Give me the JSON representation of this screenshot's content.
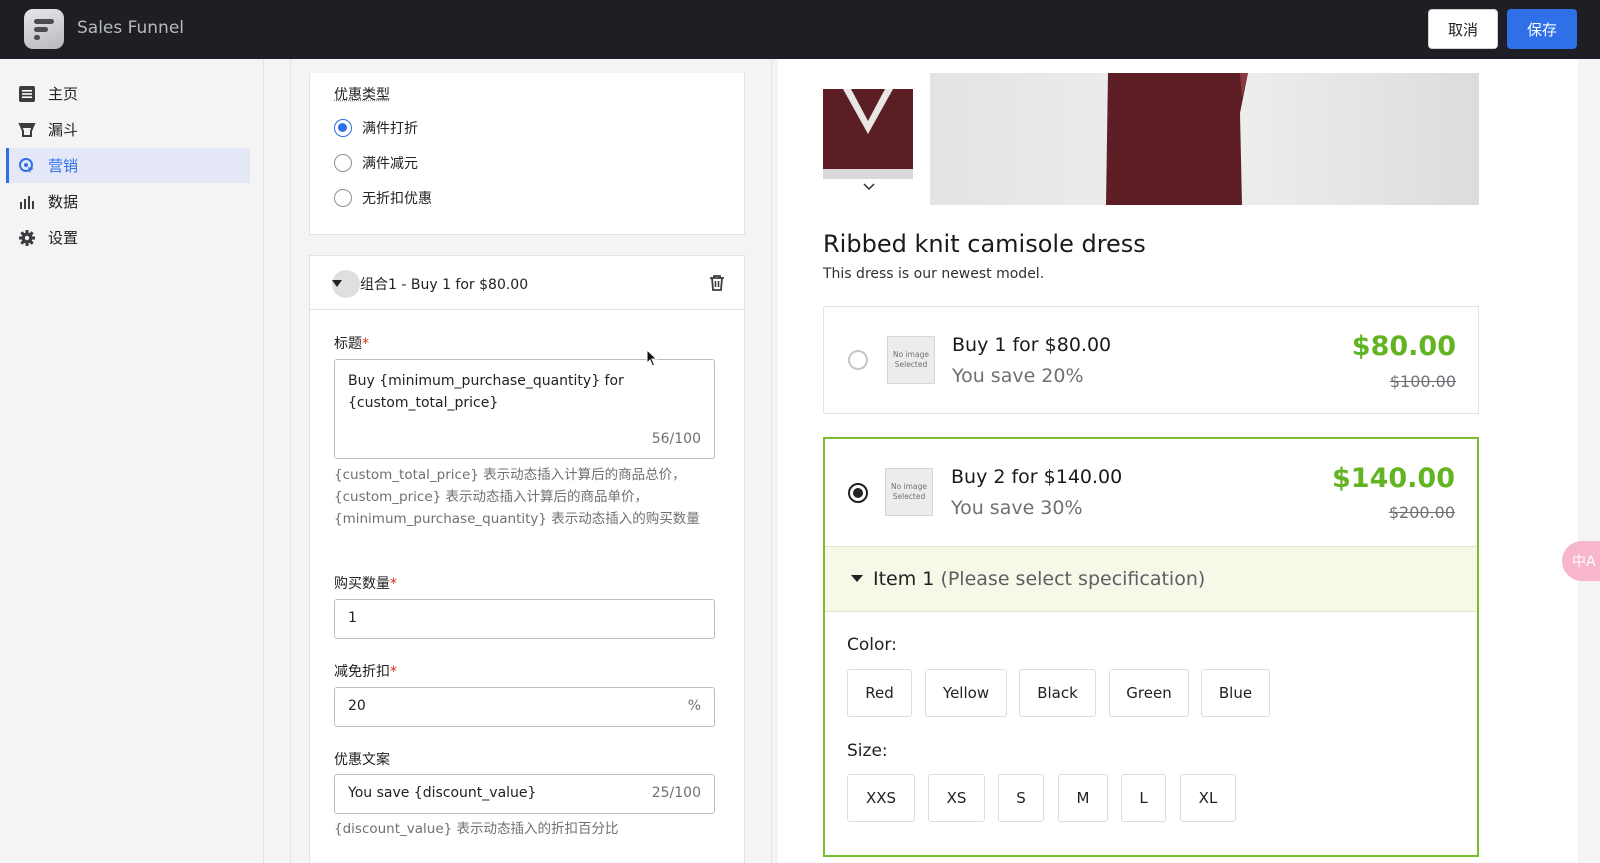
{
  "app": {
    "title": "Sales Funnel"
  },
  "topbar": {
    "cancel_label": "取消",
    "save_label": "保存"
  },
  "sidebar": {
    "items": [
      {
        "label": "主页",
        "icon": "list-icon"
      },
      {
        "label": "漏斗",
        "icon": "funnel-icon"
      },
      {
        "label": "营销",
        "icon": "marketing-icon",
        "active": true
      },
      {
        "label": "数据",
        "icon": "bar-chart-icon"
      },
      {
        "label": "设置",
        "icon": "gear-icon"
      }
    ]
  },
  "discount_type": {
    "label": "优惠类型",
    "options": [
      {
        "label": "满件打折",
        "selected": true
      },
      {
        "label": "满件减元",
        "selected": false
      },
      {
        "label": "无折扣优惠",
        "selected": false
      }
    ]
  },
  "group": {
    "title": "组合1 - Buy 1 for $80.00",
    "title_field": {
      "label": "标题",
      "value_line1": "Buy {minimum_purchase_quantity} for",
      "value_line2": "{custom_total_price}",
      "counter": "56/100",
      "hint": "{custom_total_price} 表示动态插入计算后的商品总价，{custom_price} 表示动态插入计算后的商品单价，{minimum_purchase_quantity} 表示动态插入的购买数量"
    },
    "quantity_field": {
      "label": "购买数量",
      "value": "1"
    },
    "discount_field": {
      "label": "减免折扣",
      "value": "20",
      "suffix": "%"
    },
    "copy_field": {
      "label": "优惠文案",
      "value": "You save {discount_value}",
      "counter": "25/100",
      "hint": "{discount_value} 表示动态插入的折扣百分比"
    }
  },
  "preview": {
    "product_title": "Ribbed knit camisole dress",
    "product_subtitle": "This dress is our newest model.",
    "no_image_text": "No image Selected",
    "offers": [
      {
        "title": "Buy 1 for $80.00",
        "save": "You save 20%",
        "price": "$80.00",
        "old_price": "$100.00",
        "selected": false
      },
      {
        "title": "Buy 2 for $140.00",
        "save": "You save 30%",
        "price": "$140.00",
        "old_price": "$200.00",
        "selected": true
      }
    ],
    "item": {
      "name": "Item 1",
      "note": "(Please select specification)"
    },
    "color_label": "Color:",
    "colors": [
      "Red",
      "Yellow",
      "Black",
      "Green",
      "Blue"
    ],
    "size_label": "Size:",
    "sizes": [
      "XXS",
      "XS",
      "S",
      "M",
      "L",
      "XL"
    ]
  },
  "translate_widget": {
    "label": "中A"
  },
  "colors": {
    "accent": "#2f6fe8",
    "price_green": "#63b422",
    "selected_border": "#7cbf2c"
  }
}
